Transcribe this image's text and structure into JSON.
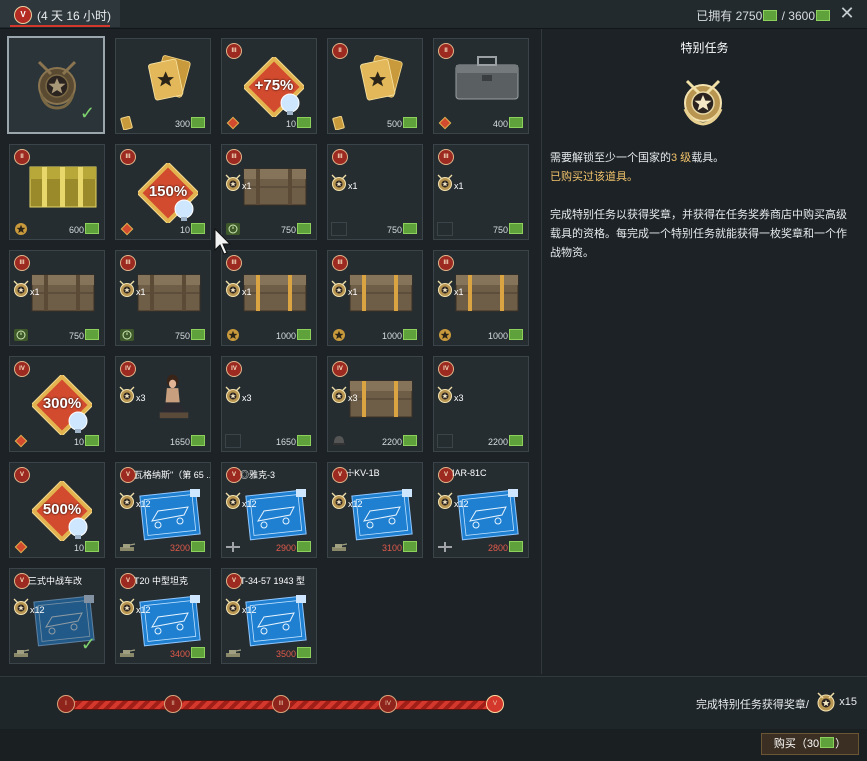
{
  "header": {
    "rank_badge": "V",
    "timer": "(4 天 16 小时)",
    "owned_label": "已拥有",
    "owned_value": "2750",
    "owned_sep": " / ",
    "owned_max": "3600",
    "close": "✕"
  },
  "cells": [
    {
      "id": "c0",
      "rank": "",
      "price": "",
      "qty": "",
      "name": "",
      "icon": "medal",
      "check": true,
      "selected": true
    },
    {
      "id": "c1",
      "rank": "",
      "price": "300",
      "qty": "",
      "name": "",
      "icon": "gold-card",
      "corner": "gold-card-icon"
    },
    {
      "id": "c2",
      "rank": "III",
      "price": "10",
      "qty": "",
      "name": "",
      "icon": "boost-75",
      "boost": "+75%",
      "corner": "diamond-icon"
    },
    {
      "id": "c3",
      "rank": "II",
      "price": "500",
      "qty": "",
      "name": "",
      "icon": "gold-card",
      "corner": "gold-card-icon"
    },
    {
      "id": "c4",
      "rank": "II",
      "price": "400",
      "qty": "",
      "name": "",
      "icon": "steel-case",
      "corner": "diamond-icon"
    },
    {
      "id": "c5",
      "rank": "II",
      "price": "600",
      "qty": "",
      "name": "",
      "icon": "gold-chest",
      "corner": "star-icon"
    },
    {
      "id": "c6",
      "rank": "III",
      "price": "10",
      "qty": "",
      "name": "",
      "icon": "boost-150",
      "boost": "150%",
      "corner": "diamond-icon"
    },
    {
      "id": "c7",
      "rank": "III",
      "price": "750",
      "qty": "x1",
      "name": "",
      "icon": "crate",
      "corner": "clock-icon"
    },
    {
      "id": "c8",
      "rank": "III",
      "price": "750",
      "qty": "x1",
      "name": "",
      "icon": "empty",
      "corner": "box"
    },
    {
      "id": "c9",
      "rank": "III",
      "price": "750",
      "qty": "x1",
      "name": "",
      "icon": "empty",
      "corner": "box"
    },
    {
      "id": "c10",
      "rank": "III",
      "price": "750",
      "qty": "x1",
      "name": "",
      "icon": "crate",
      "corner": "clock-icon"
    },
    {
      "id": "c11",
      "rank": "III",
      "price": "750",
      "qty": "x1",
      "name": "",
      "icon": "crate",
      "corner": "clock-icon"
    },
    {
      "id": "c12",
      "rank": "III",
      "price": "1000",
      "qty": "x1",
      "name": "",
      "icon": "crate-gold",
      "corner": "star-icon"
    },
    {
      "id": "c13",
      "rank": "III",
      "price": "1000",
      "qty": "x1",
      "name": "",
      "icon": "crate-gold",
      "corner": "star-icon"
    },
    {
      "id": "c14",
      "rank": "III",
      "price": "1000",
      "qty": "x1",
      "name": "",
      "icon": "crate-gold",
      "corner": "star-icon"
    },
    {
      "id": "c15",
      "rank": "IV",
      "price": "10",
      "qty": "",
      "name": "",
      "icon": "boost-300",
      "boost": "300%",
      "corner": "diamond-icon"
    },
    {
      "id": "c16",
      "rank": "IV",
      "price": "1650",
      "qty": "x3",
      "name": "",
      "icon": "pinup",
      "corner": ""
    },
    {
      "id": "c17",
      "rank": "IV",
      "price": "1650",
      "qty": "x3",
      "name": "",
      "icon": "empty",
      "corner": "box"
    },
    {
      "id": "c18",
      "rank": "IV",
      "price": "2200",
      "qty": "x3",
      "name": "",
      "icon": "crate-gold",
      "corner": "helmet-icon"
    },
    {
      "id": "c19",
      "rank": "IV",
      "price": "2200",
      "qty": "x3",
      "name": "",
      "icon": "empty",
      "corner": "box"
    },
    {
      "id": "c20",
      "rank": "V",
      "price": "10",
      "qty": "",
      "name": "",
      "icon": "boost-500",
      "boost": "500%",
      "corner": "diamond-icon"
    },
    {
      "id": "c21",
      "rank": "V",
      "price": "3200",
      "qty": "x12",
      "name": "瓦格纳斯\"（第 65 ...",
      "icon": "blueprint",
      "corner": "tank-icon",
      "red": true
    },
    {
      "id": "c22",
      "rank": "V",
      "price": "2900",
      "qty": "x12",
      "name": "◎雅克-3",
      "icon": "blueprint",
      "corner": "plane-icon",
      "red": true
    },
    {
      "id": "c23",
      "rank": "V",
      "price": "3100",
      "qty": "x12",
      "name": "☩KV-1B",
      "icon": "blueprint",
      "corner": "tank-icon",
      "red": true
    },
    {
      "id": "c24",
      "rank": "V",
      "price": "2800",
      "qty": "x12",
      "name": "IAR-81C",
      "icon": "blueprint",
      "corner": "plane-icon",
      "red": true
    },
    {
      "id": "c25",
      "rank": "V",
      "price": "",
      "qty": "x12",
      "name": "三式中战车改",
      "icon": "blueprint-dim",
      "corner": "tank-icon",
      "check": true
    },
    {
      "id": "c26",
      "rank": "V",
      "price": "3400",
      "qty": "x12",
      "name": "T20 中型坦克",
      "icon": "blueprint",
      "corner": "tank-icon",
      "red": true
    },
    {
      "id": "c27",
      "rank": "V",
      "price": "3500",
      "qty": "x12",
      "name": "T-34-57 1943 型",
      "icon": "blueprint",
      "corner": "tank-icon",
      "red": true
    }
  ],
  "side": {
    "title": "特别任务",
    "req_prefix": "需要解锁至少一个国家的",
    "req_highlight": "3 级",
    "req_suffix": "载具。",
    "bought": "已购买过该道具。",
    "desc": "完成特别任务以获得奖章，并获得在任务奖券商店中购买高级载具的资格。每完成一个特别任务就能获得一枚奖章和一个作战物资。"
  },
  "progress": {
    "nodes": [
      "I",
      "II",
      "III",
      "IV",
      "V"
    ],
    "reward_text": "完成特别任务获得奖章/",
    "reward_count": "x15"
  },
  "footer": {
    "buy_label": "购买（30",
    "buy_suffix": "）"
  },
  "colors": {
    "accent": "#d4372c",
    "gold": "#f2c36b",
    "bg": "#1c2226",
    "cell": "#252d31"
  }
}
